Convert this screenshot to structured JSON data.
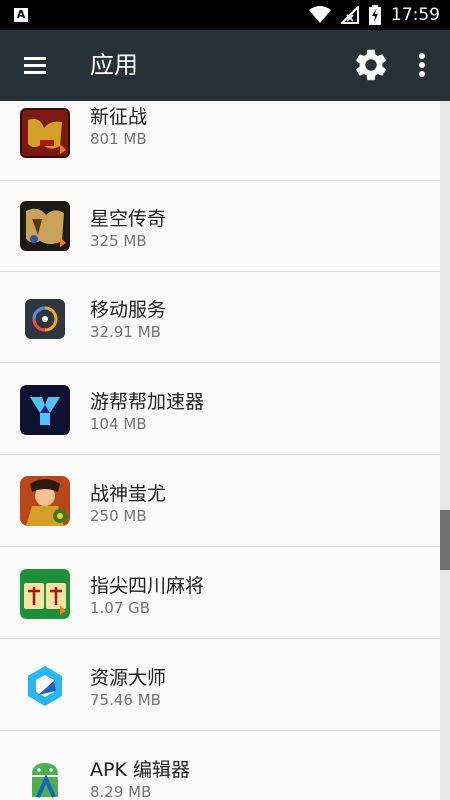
{
  "status_bar": {
    "notification_icon": "A",
    "time": "17:59",
    "icons": [
      "wifi-icon",
      "no-signal-icon",
      "battery-charging-icon"
    ]
  },
  "app_bar": {
    "title": "应用",
    "icons": [
      "menu-icon",
      "settings-icon",
      "more-vert-icon"
    ],
    "color": "#263238"
  },
  "apps": [
    {
      "name": "新征战",
      "size": "801 MB",
      "icon": "game-icon-xinzhengzhan"
    },
    {
      "name": "星空传奇",
      "size": "325 MB",
      "icon": "game-icon-xingkongchuanqi"
    },
    {
      "name": "移动服务",
      "size": "32.91 MB",
      "icon": "mobile-service-icon"
    },
    {
      "name": "游帮帮加速器",
      "size": "104 MB",
      "icon": "accelerator-icon"
    },
    {
      "name": "战神蚩尤",
      "size": "250 MB",
      "icon": "game-icon-zhanshenchiyou"
    },
    {
      "name": "指尖四川麻将",
      "size": "1.07 GB",
      "icon": "mahjong-icon"
    },
    {
      "name": "资源大师",
      "size": "75.46 MB",
      "icon": "resource-master-icon"
    },
    {
      "name": "APK 编辑器",
      "size": "8.29 MB",
      "icon": "apk-editor-icon"
    }
  ],
  "scrollbar": {
    "thumb_color": "#6f6f6f"
  }
}
